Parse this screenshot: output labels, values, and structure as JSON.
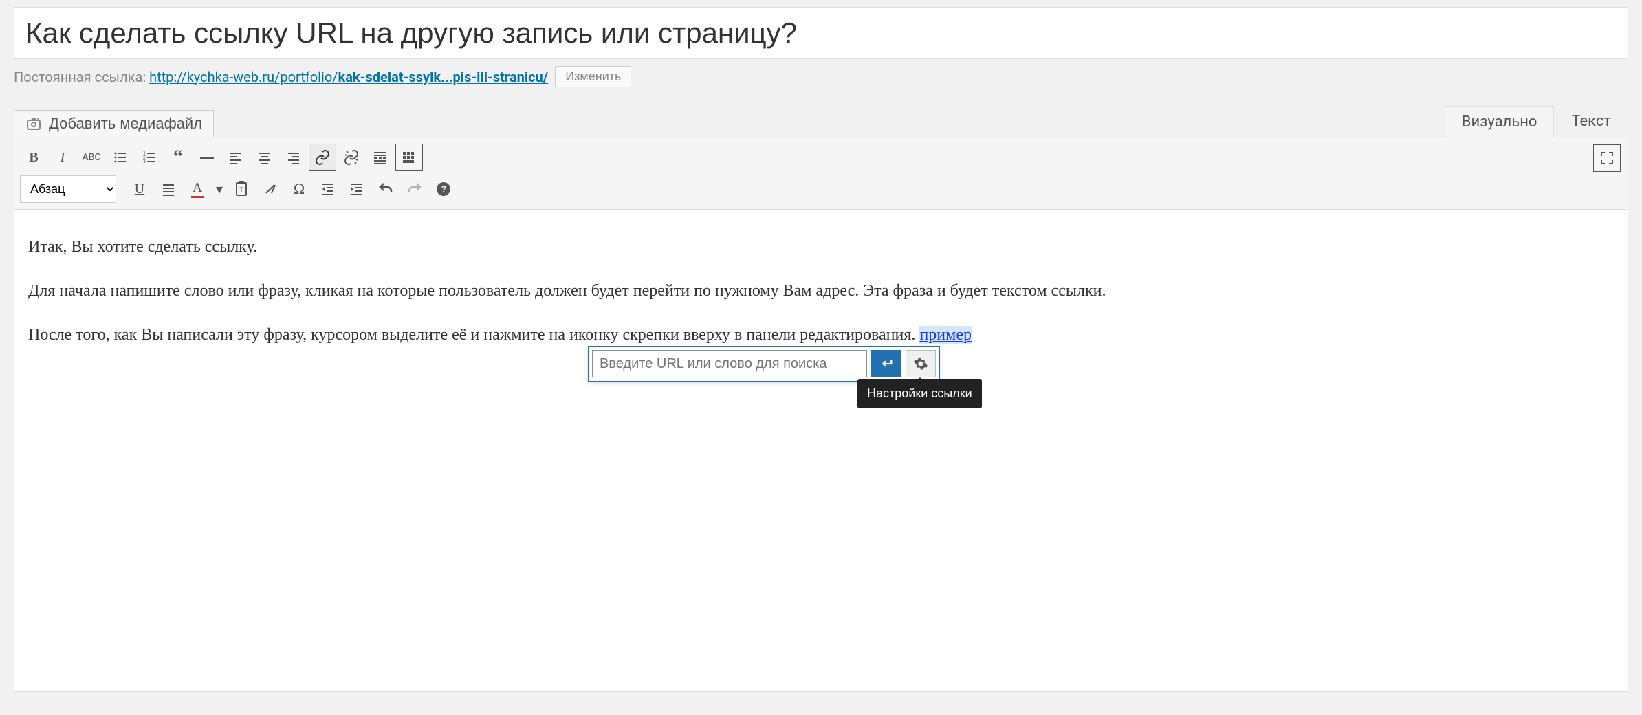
{
  "title": "Как сделать ссылку URL на другую запись или страницу?",
  "permalink": {
    "label": "Постоянная ссылка:",
    "base": "http://kychka-web.ru/portfolio/",
    "slug": "kak-sdelat-ssylk...pis-ili-stranicu/",
    "edit_label": "Изменить"
  },
  "media_button": "Добавить медиафайл",
  "tabs": {
    "visual": "Визуально",
    "text": "Текст"
  },
  "format_select": "Абзац",
  "content": {
    "p1": "Итак, Вы хотите сделать ссылку.",
    "p2": "Для начала напишите слово или фразу, кликая на которые пользователь должен будет перейти по нужному Вам адрес. Эта фраза и будет текстом ссылки.",
    "p3_before": "После того, как Вы написали эту фразу, курсором выделите её и нажмите на иконку скрепки вверху в панели редактирования. ",
    "p3_link": "пример"
  },
  "link_popup": {
    "placeholder": "Введите URL или слово для поиска",
    "tooltip": "Настройки ссылки"
  }
}
